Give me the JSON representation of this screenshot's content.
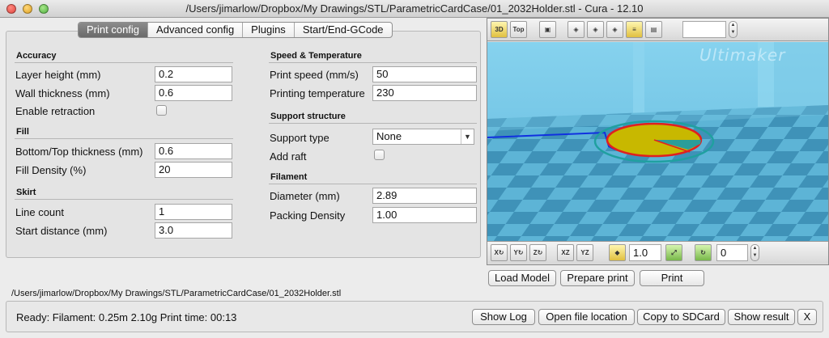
{
  "window": {
    "title": "/Users/jimarlow/Dropbox/My Drawings/STL/ParametricCardCase/01_2032Holder.stl - Cura - 12.10"
  },
  "tabs": [
    {
      "label": "Print config",
      "active": true
    },
    {
      "label": "Advanced config",
      "active": false
    },
    {
      "label": "Plugins",
      "active": false
    },
    {
      "label": "Start/End-GCode",
      "active": false
    }
  ],
  "accuracy": {
    "title": "Accuracy",
    "layer_height_label": "Layer height (mm)",
    "layer_height_value": "0.2",
    "wall_thickness_label": "Wall thickness (mm)",
    "wall_thickness_value": "0.6",
    "enable_retraction_label": "Enable retraction",
    "enable_retraction_checked": false
  },
  "fill": {
    "title": "Fill",
    "bottom_top_label": "Bottom/Top thickness (mm)",
    "bottom_top_value": "0.6",
    "density_label": "Fill Density (%)",
    "density_value": "20"
  },
  "skirt": {
    "title": "Skirt",
    "line_count_label": "Line count",
    "line_count_value": "1",
    "start_distance_label": "Start distance (mm)",
    "start_distance_value": "3.0"
  },
  "speed": {
    "title": "Speed & Temperature",
    "print_speed_label": "Print speed (mm/s)",
    "print_speed_value": "50",
    "print_temp_label": "Printing temperature",
    "print_temp_value": "230"
  },
  "support": {
    "title": "Support structure",
    "type_label": "Support type",
    "type_value": "None",
    "raft_label": "Add raft",
    "raft_checked": false
  },
  "filament": {
    "title": "Filament",
    "diameter_label": "Diameter (mm)",
    "diameter_value": "2.89",
    "packing_label": "Packing Density",
    "packing_value": "1.00"
  },
  "viewer": {
    "top_toolbar": {
      "icons": [
        "view-3d-icon",
        "view-top-icon",
        "load-icon",
        "cube-front-icon",
        "cube-side-icon",
        "cube-top-icon",
        "layers-icon",
        "gcode-icon"
      ],
      "view_3d_label": "3D",
      "view_top_label": "Top",
      "layer_value": ""
    },
    "bottom_toolbar": {
      "scale_value": "1.0",
      "rotate_value": "0",
      "xz_label": "XZ",
      "yz_label": "YZ"
    },
    "brand_text": "Ultimaker",
    "colors": {
      "sky": "#72c6e6",
      "floor_light": "#5fb6d6",
      "floor_dark": "#3e8db2",
      "model_yellow": "#c8b800",
      "model_outline": "#e02020",
      "skirt": "#20a0a0",
      "path": "#1030e0"
    }
  },
  "actions": {
    "load_model": "Load Model",
    "prepare_print": "Prepare print",
    "print": "Print"
  },
  "file_path": "/Users/jimarlow/Dropbox/My Drawings/STL/ParametricCardCase/01_2032Holder.stl",
  "status": {
    "text": "Ready: Filament: 0.25m 2.10g Print time: 00:13",
    "show_log": "Show Log",
    "open_location": "Open file location",
    "copy_sd": "Copy to SDCard",
    "show_result": "Show result",
    "close": "X"
  }
}
